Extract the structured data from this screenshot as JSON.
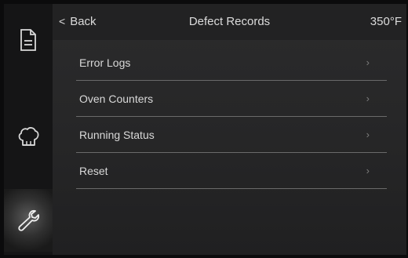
{
  "header": {
    "back_label": "Back",
    "title": "Defect Records",
    "temperature": "350°F"
  },
  "sidebar": {
    "items": [
      {
        "icon": "document-icon",
        "active": false
      },
      {
        "icon": "chef-hat-icon",
        "active": false
      },
      {
        "icon": "wrench-icon",
        "active": true
      }
    ]
  },
  "menu": {
    "items": [
      {
        "label": "Error Logs",
        "arrow": "›"
      },
      {
        "label": "Oven Counters",
        "arrow": "›"
      },
      {
        "label": "Running Status",
        "arrow": "›"
      },
      {
        "label": "Reset",
        "arrow": "›"
      }
    ]
  },
  "colors": {
    "background": "#0b0b0c",
    "panel": "#262627",
    "text": "#dcdcdc",
    "divider": "#6a6a6a",
    "arrow": "#7c7c7c"
  }
}
